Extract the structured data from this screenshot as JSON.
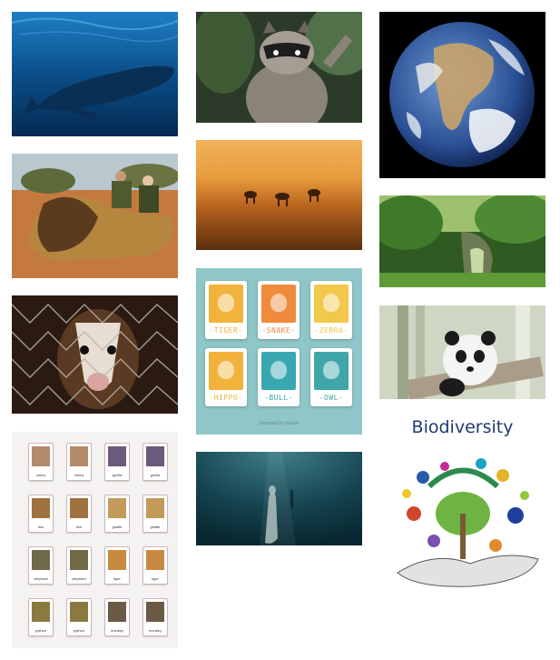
{
  "gallery": {
    "tiles": [
      {
        "name": "blue-whale-photo",
        "subject": "whale"
      },
      {
        "name": "hunters-with-lion-photo",
        "subject": "lion"
      },
      {
        "name": "civet-behind-fence-photo",
        "subject": "civet"
      },
      {
        "name": "animal-memory-cards-photo",
        "subject": "cards"
      },
      {
        "name": "raccoon-photo",
        "subject": "raccoon"
      },
      {
        "name": "savanna-animals-running-photo",
        "subject": "savanna"
      },
      {
        "name": "animal-flashcards-illustration",
        "subject": "flashcards"
      },
      {
        "name": "underwater-diver-photo",
        "subject": "underwater"
      },
      {
        "name": "earth-from-space-photo",
        "subject": "earth"
      },
      {
        "name": "jungle-ruins-photo",
        "subject": "jungle"
      },
      {
        "name": "panda-cub-photo",
        "subject": "panda"
      },
      {
        "name": "biodiversity-illustration",
        "subject": "biodiversity"
      }
    ]
  },
  "flashcards": {
    "cards": [
      {
        "label": "-TIGER-",
        "animal": "tiger",
        "bg": "#f2b33d"
      },
      {
        "label": "-SNAKE-",
        "animal": "snake",
        "bg": "#f08a3c"
      },
      {
        "label": "-ZEBRA-",
        "animal": "zebra",
        "bg": "#f2c84b"
      },
      {
        "label": "-HIPPO-",
        "animal": "hippo",
        "bg": "#f2b33d"
      },
      {
        "label": "-BULL-",
        "animal": "bull",
        "bg": "#39a7b0"
      },
      {
        "label": "-OWL-",
        "animal": "owl",
        "bg": "#3ea6a8"
      }
    ],
    "credit": "Designed by freepik"
  },
  "memory_cards": {
    "labels": [
      "zebra",
      "zebra",
      "gorilla",
      "gorilla",
      "lion",
      "lion",
      "giraffe",
      "giraffe",
      "elephant",
      "elephant",
      "tiger",
      "tiger",
      "python",
      "python",
      "monkey",
      "monkey"
    ]
  },
  "biodiversity": {
    "title": "Biodiversity"
  },
  "colors": {
    "flashcard_bg": "#8fc7c9",
    "bio_title": "#1f3b73"
  }
}
